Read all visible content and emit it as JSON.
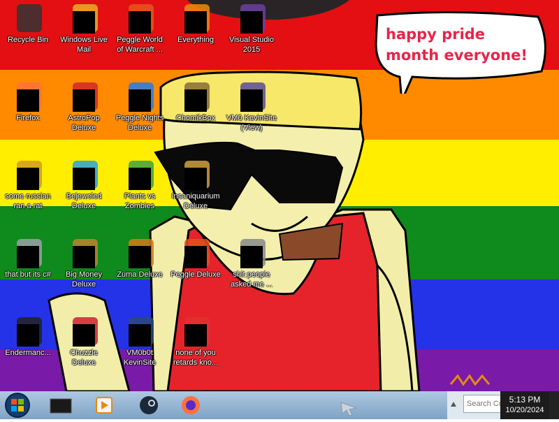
{
  "speech_bubble": {
    "text": "happy pride month everyone!"
  },
  "desktop_icons": [
    {
      "label": "Recycle Bin",
      "icon": "recycle-bin-icon"
    },
    {
      "label": "Windows Live\nMail",
      "icon": "mail-icon"
    },
    {
      "label": "Peggle World\nof Warcraft ...",
      "icon": "peggle-icon"
    },
    {
      "label": "Everything",
      "icon": "search-icon"
    },
    {
      "label": "Visual Studio\n2015",
      "icon": "visual-studio-icon"
    },
    {
      "label": "Firefox",
      "icon": "firefox-icon"
    },
    {
      "label": "AstroPop\nDeluxe",
      "icon": "astropop-icon"
    },
    {
      "label": "Peggle Nights\nDeluxe",
      "icon": "peggle-nights-icon"
    },
    {
      "label": "ChomikBox",
      "icon": "chomikbox-icon"
    },
    {
      "label": "VM0 KevinSite\n(View)",
      "icon": "vm-icon"
    },
    {
      "label": "some russian\nran a rat",
      "icon": "document-icon"
    },
    {
      "label": "Bejeweled\nDeluxe",
      "icon": "bejeweled-icon"
    },
    {
      "label": "Plants vs\nZombies",
      "icon": "plants-icon"
    },
    {
      "label": "Insaniquarium\nDeluxe",
      "icon": "insaniquarium-icon"
    },
    {
      "label": "that but its c#",
      "icon": "copy-icon"
    },
    {
      "label": "Big Money\nDeluxe",
      "icon": "big-money-icon"
    },
    {
      "label": "Zuma Deluxe",
      "icon": "zuma-icon"
    },
    {
      "label": "Peggle Deluxe",
      "icon": "peggle-deluxe-icon"
    },
    {
      "label": "shit people\nasked me ...",
      "icon": "folder-icon"
    },
    {
      "label": "Endermanc...",
      "icon": "terminal-icon"
    },
    {
      "label": "Chuzzle\nDeluxe",
      "icon": "chuzzle-icon"
    },
    {
      "label": "VM0b0t\nKevinSite",
      "icon": "vm-bot-icon"
    },
    {
      "label": "none of you\nretards kno...",
      "icon": "shortcut-icon"
    }
  ],
  "taskbar": {
    "start": "start-orb-icon",
    "items": [
      "command-icon",
      "media-player-icon",
      "steam-icon",
      "firefox-icon"
    ],
    "search_placeholder": "Search Co",
    "clock_time": "5:13 PM",
    "clock_date": "10/20/2024"
  },
  "colors": {
    "red": "#e30f12",
    "orange": "#ff8a00",
    "yellow": "#ffee00",
    "green": "#0f8a1c",
    "blue": "#2432e8",
    "purple": "#7a1aa8",
    "bubble_text": "#e8244a"
  }
}
